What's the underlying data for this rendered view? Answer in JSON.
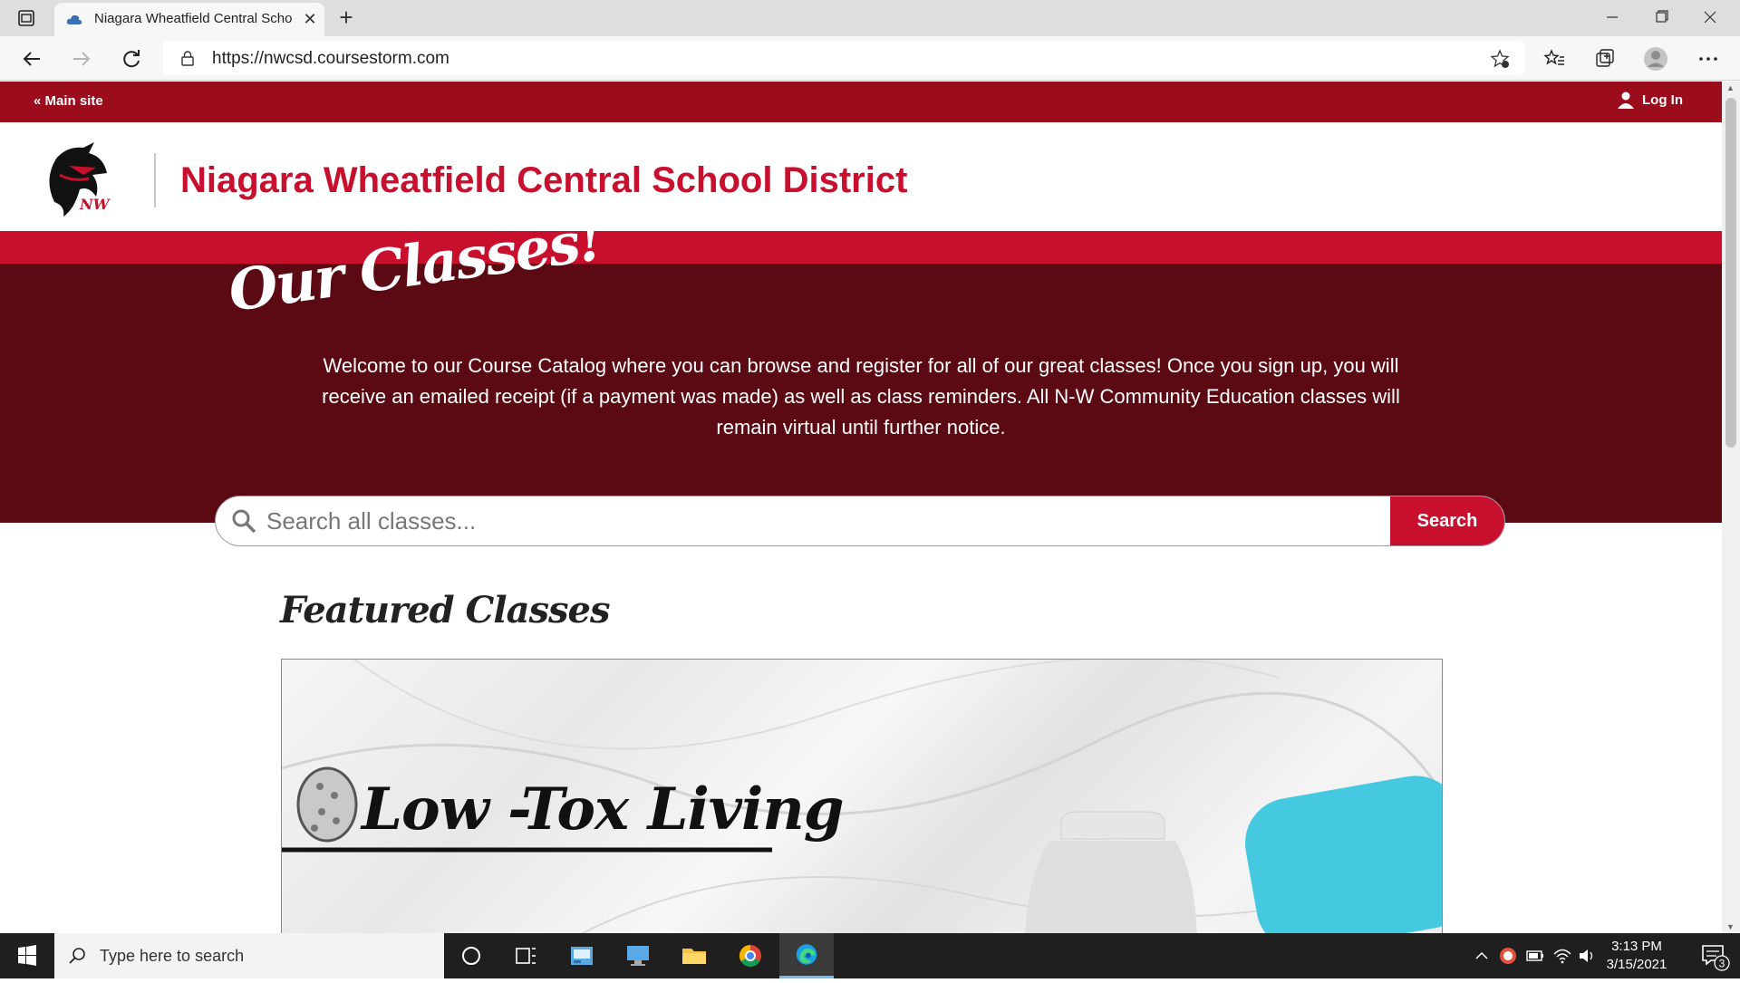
{
  "browser": {
    "tab_title": "Niagara Wheatfield Central Scho",
    "url": "https://nwcsd.coursestorm.com"
  },
  "topbar": {
    "main_site": "« Main site",
    "login": "Log In"
  },
  "header": {
    "site_name": "Niagara Wheatfield Central School District"
  },
  "hero": {
    "title": "Our Classes!",
    "text": "Welcome to our Course Catalog where you can browse and register for all of our great classes! Once you sign up, you will receive an emailed receipt (if a payment was made) as well as class reminders. All N-W Community Education classes will remain virtual until further notice."
  },
  "search": {
    "placeholder": "Search all classes...",
    "button": "Search"
  },
  "featured": {
    "title": "Featured Classes",
    "card_title": "Low -Tox Living"
  },
  "taskbar": {
    "search_placeholder": "Type here to search",
    "time": "3:13 PM",
    "date": "3/15/2021",
    "notifications": "3"
  },
  "colors": {
    "brand_red": "#c8102e",
    "topbar_red": "#9b0c1d",
    "hero_maroon": "#5b0912"
  }
}
